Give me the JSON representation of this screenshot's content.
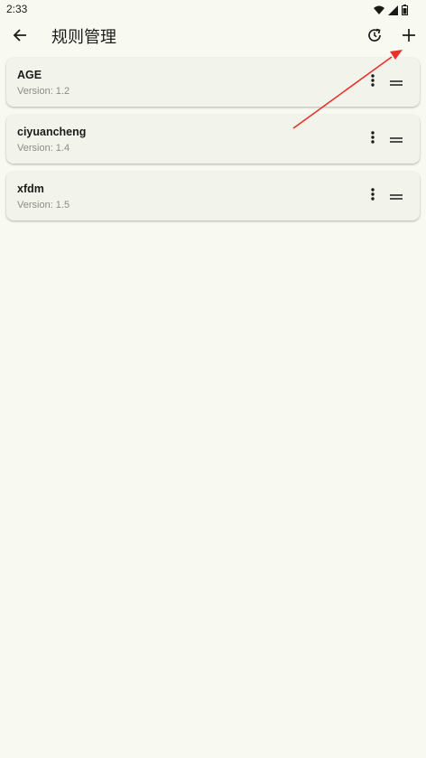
{
  "status_bar": {
    "time": "2:33",
    "icons": [
      "wifi-icon",
      "signal-icon",
      "battery-icon"
    ]
  },
  "app_bar": {
    "title": "规则管理",
    "back_icon": "arrow-left-icon",
    "actions": [
      "history-icon",
      "add-icon"
    ]
  },
  "rules": [
    {
      "name": "AGE",
      "version": "Version: 1.2"
    },
    {
      "name": "ciyuancheng",
      "version": "Version: 1.4"
    },
    {
      "name": "xfdm",
      "version": "Version: 1.5"
    }
  ],
  "annotation": {
    "color": "#e8312a",
    "target": "add-button"
  }
}
